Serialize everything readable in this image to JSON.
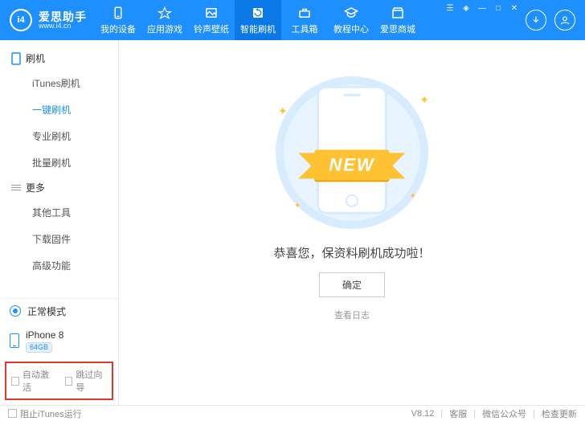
{
  "brand": {
    "logo_text": "i4",
    "cn": "爱思助手",
    "url": "www.i4.cn"
  },
  "nav": {
    "items": [
      {
        "label": "我的设备"
      },
      {
        "label": "应用游戏"
      },
      {
        "label": "铃声壁纸"
      },
      {
        "label": "智能刷机"
      },
      {
        "label": "工具箱"
      },
      {
        "label": "教程中心"
      },
      {
        "label": "爱思商城"
      }
    ]
  },
  "sidebar": {
    "group1": {
      "title": "刷机",
      "items": [
        "iTunes刷机",
        "一键刷机",
        "专业刷机",
        "批量刷机"
      ]
    },
    "group2": {
      "title": "更多",
      "items": [
        "其他工具",
        "下载固件",
        "高级功能"
      ]
    },
    "mode": "正常模式",
    "device": {
      "name": "iPhone 8",
      "capacity": "64GB"
    },
    "auto_activate": "自动激活",
    "skip_wizard": "跳过向导"
  },
  "main": {
    "ribbon": "NEW",
    "message": "恭喜您，保资料刷机成功啦！",
    "ok": "确定",
    "view_log": "查看日志"
  },
  "footer": {
    "block_itunes": "阻止iTunes运行",
    "version": "V8.12",
    "support": "客服",
    "wechat": "微信公众号",
    "check_update": "检查更新"
  }
}
